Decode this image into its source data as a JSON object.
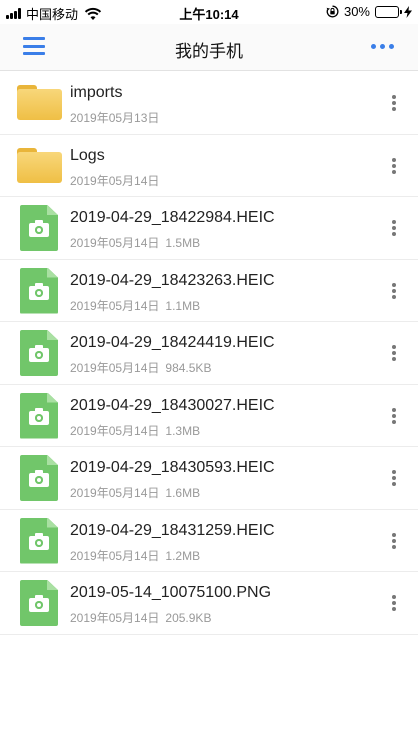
{
  "status_bar": {
    "carrier": "中国移动",
    "time": "上午10:14",
    "battery_percent": "30%",
    "battery_level": 0.3,
    "battery_color": "#4cd964"
  },
  "nav": {
    "title": "我的手机",
    "menu_icon": "hamburger-icon",
    "more_icon": "more-dots-icon",
    "accent_color": "#3a7ee8"
  },
  "files": [
    {
      "type": "folder",
      "name": "imports",
      "date": "2019年05月13日",
      "size": ""
    },
    {
      "type": "folder",
      "name": "Logs",
      "date": "2019年05月14日",
      "size": ""
    },
    {
      "type": "image",
      "name": "2019-04-29_18422984.HEIC",
      "date": "2019年05月14日",
      "size": "1.5MB"
    },
    {
      "type": "image",
      "name": "2019-04-29_18423263.HEIC",
      "date": "2019年05月14日",
      "size": "1.1MB"
    },
    {
      "type": "image",
      "name": "2019-04-29_18424419.HEIC",
      "date": "2019年05月14日",
      "size": "984.5KB"
    },
    {
      "type": "image",
      "name": "2019-04-29_18430027.HEIC",
      "date": "2019年05月14日",
      "size": "1.3MB"
    },
    {
      "type": "image",
      "name": "2019-04-29_18430593.HEIC",
      "date": "2019年05月14日",
      "size": "1.6MB"
    },
    {
      "type": "image",
      "name": "2019-04-29_18431259.HEIC",
      "date": "2019年05月14日",
      "size": "1.2MB"
    },
    {
      "type": "image",
      "name": "2019-05-14_10075100.PNG",
      "date": "2019年05月14日",
      "size": "205.9KB"
    }
  ]
}
